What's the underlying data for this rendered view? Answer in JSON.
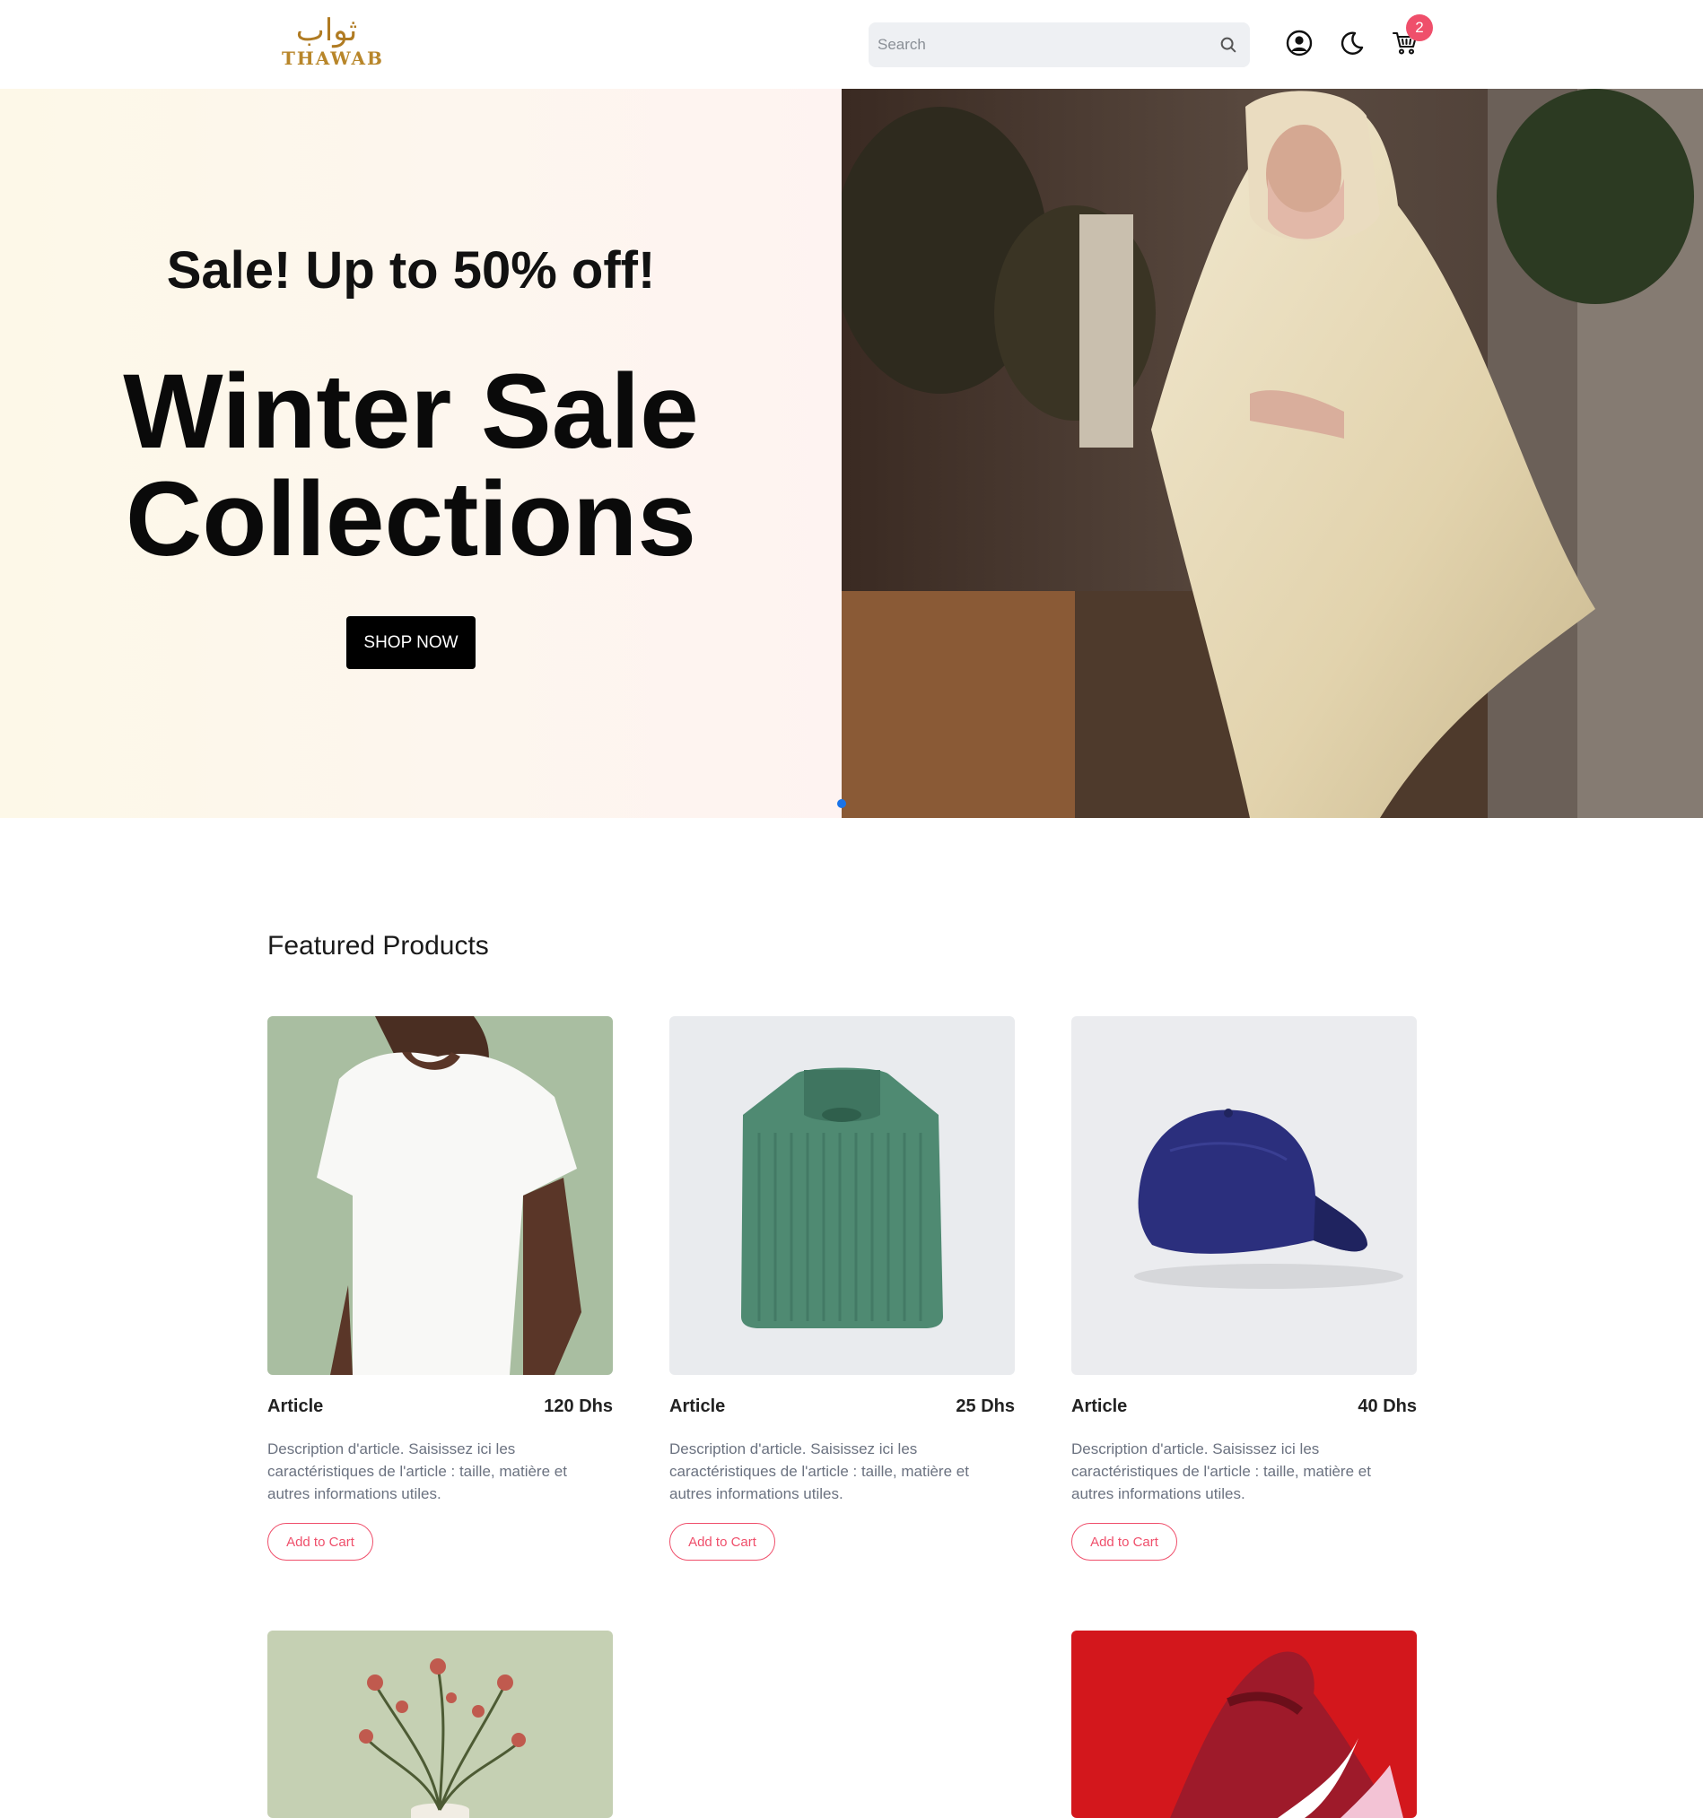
{
  "header": {
    "logo_arabic": "ثواب",
    "logo_latin": "THAWAB",
    "search_placeholder": "Search",
    "cart_count": "2",
    "icons": [
      "search-icon",
      "user-icon",
      "moon-icon",
      "cart-icon"
    ]
  },
  "hero": {
    "subtitle": "Sale! Up to 50% off!",
    "title_line1": "Winter Sale",
    "title_line2": "Collections",
    "cta": "SHOP NOW"
  },
  "featured": {
    "title": "Featured Products",
    "products": [
      {
        "name": "Article",
        "price": "120 Dhs",
        "description": "Description d'article. Saisissez ici les caractéristiques de l'article : taille, matière et autres informations utiles.",
        "button": "Add to Cart"
      },
      {
        "name": "Article",
        "price": "25 Dhs",
        "description": "Description d'article. Saisissez ici les caractéristiques de l'article : taille, matière et autres informations utiles.",
        "button": "Add to Cart"
      },
      {
        "name": "Article",
        "price": "40 Dhs",
        "description": "Description d'article. Saisissez ici les caractéristiques de l'article : taille, matière et autres informations utiles.",
        "button": "Add to Cart"
      }
    ]
  },
  "colors": {
    "accent": "#ef4f6b",
    "logo_gold": "#b8862a",
    "carousel_dot": "#1a73e8"
  }
}
